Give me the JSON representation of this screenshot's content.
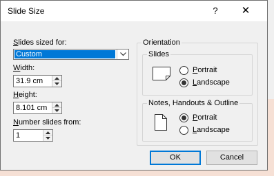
{
  "dialog": {
    "title": "Slide Size",
    "help_glyph": "?",
    "close_glyph": "✕"
  },
  "slides_sized_for": {
    "label_accel": "S",
    "label_rest": "lides sized for:",
    "value": "Custom"
  },
  "width": {
    "label_accel": "W",
    "label_rest": "idth:",
    "value": "31.9 cm"
  },
  "height": {
    "label_accel": "H",
    "label_rest": "eight:",
    "value": "8.101 cm"
  },
  "number_from": {
    "label_accel": "N",
    "label_rest": "umber slides from:",
    "value": "1"
  },
  "orientation": {
    "title": "Orientation",
    "slides": {
      "title": "Slides",
      "portrait_accel": "P",
      "portrait_rest": "ortrait",
      "landscape_accel": "L",
      "landscape_rest": "andscape",
      "selected": "landscape"
    },
    "notes": {
      "title": "Notes, Handouts & Outline",
      "portrait_accel": "P",
      "portrait_rest": "ortrait",
      "landscape_accel": "L",
      "landscape_rest": "andscape",
      "selected": "portrait"
    }
  },
  "buttons": {
    "ok": "OK",
    "cancel": "Cancel"
  },
  "colors": {
    "accent": "#0078d7",
    "background_behind": "#f6e0d5"
  }
}
